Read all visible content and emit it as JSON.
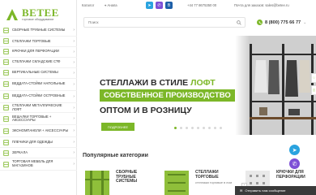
{
  "logo": {
    "text": "BETEE",
    "subtitle": "торговое оборудование"
  },
  "topbar": {
    "catalog": "Каталог",
    "city": "Анапа",
    "phone_small": "+44 77 8675350 00",
    "email": "Почта для заказов: sales@betee.ru"
  },
  "search": {
    "placeholder": "Поиск"
  },
  "header": {
    "phone": "8 (800) 775 66 77"
  },
  "sidebar": {
    "items": [
      {
        "label": "Сборные трубные системы",
        "tall": true
      },
      {
        "label": "Стеллажи торговые",
        "tall": false
      },
      {
        "label": "Крючки для перфорации",
        "tall": false
      },
      {
        "label": "Стеллажи складские СТФ",
        "tall": false
      },
      {
        "label": "Вертикальные системы",
        "tall": false
      },
      {
        "label": "Веддата-стойки напольные",
        "tall": true
      },
      {
        "label": "Веддата-стойки островные",
        "tall": true
      },
      {
        "label": "Стеллажи металлические лофт",
        "tall": false
      },
      {
        "label": "Вешалки торговые + аксессуары",
        "tall": true
      },
      {
        "label": "Экономпанели + аксессуары",
        "tall": true
      },
      {
        "label": "Плечики для одежды",
        "tall": false
      },
      {
        "label": "Зеркала",
        "tall": false
      },
      {
        "label": "Торговая мебель для магазинов",
        "tall": true
      }
    ]
  },
  "hero": {
    "line1": "СТЕЛЛАЖИ В СТИЛЕ ",
    "line1_accent": "ЛОФТ",
    "line2": "СОБСТВЕННОЕ ПРОИЗВОДСТВО",
    "line3": "ОПТОМ И В РОЗНИЦУ",
    "button": "ПОДРОБНЕЕ"
  },
  "popular": {
    "title": "Популярные категории",
    "cards": [
      {
        "title1": "СБОРНЫЕ",
        "title2": "ТРУБНЫЕ",
        "title3": "СИСТЕМЫ",
        "sub": ""
      },
      {
        "title1": "СТЕЛЛАЖИ",
        "title2": "ТОРГОВЫЕ",
        "title3": "",
        "sub": "стеллажи торговые в лом"
      },
      {
        "title1": "КРЮЧКИ ДЛЯ",
        "title2": "ПЕРФОРАЦИИ",
        "title3": "",
        "sub": ""
      }
    ]
  },
  "chat": {
    "label": "Отправить нам сообщение"
  },
  "colors": {
    "brand": "#7cb728",
    "telegram": "#2aa3df",
    "viber": "#7d4fd6"
  }
}
